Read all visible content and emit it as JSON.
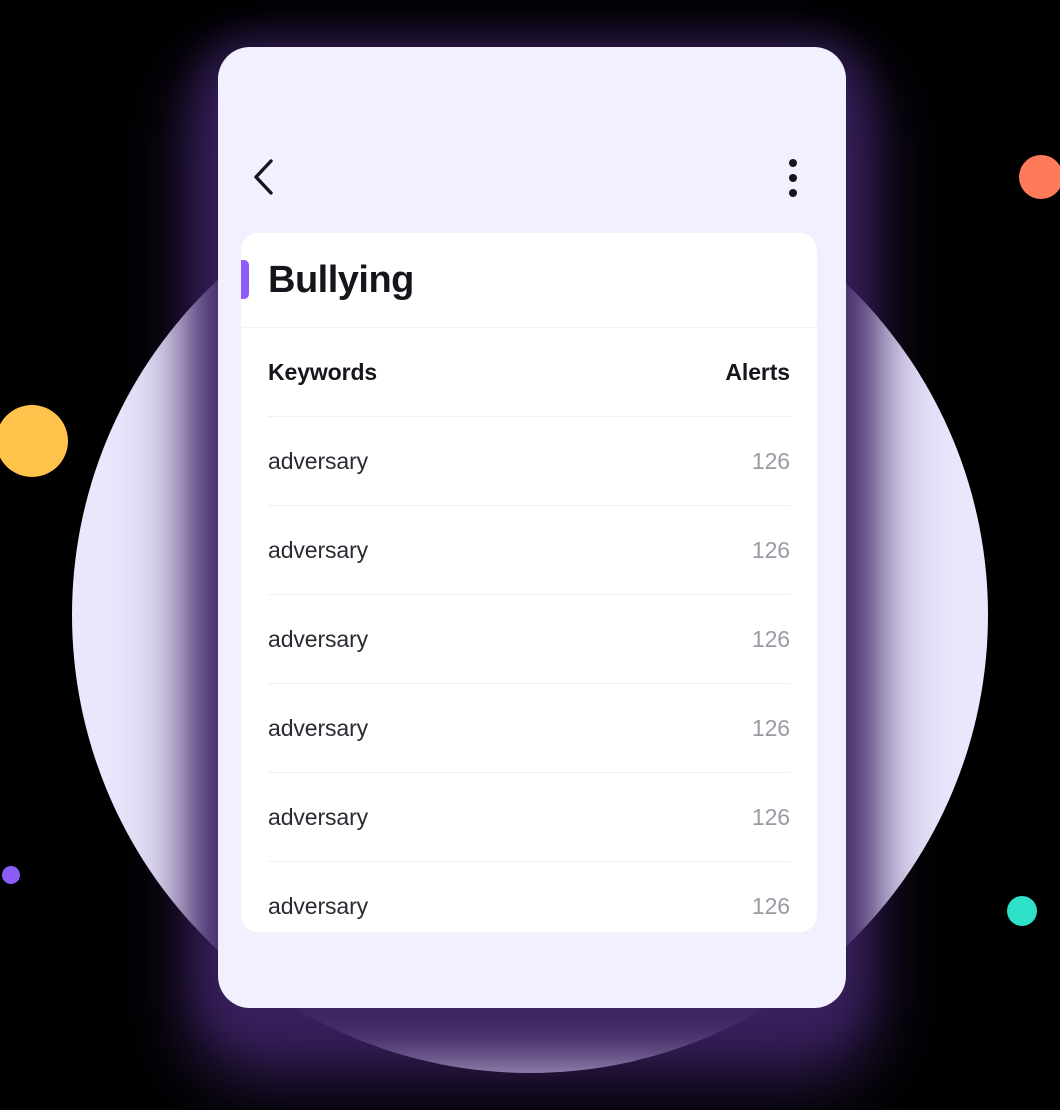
{
  "app": {
    "screen_title": "Bullying"
  },
  "topbar": {
    "back_icon": "chevron-left-icon",
    "menu_icon": "kebab-menu-icon"
  },
  "table": {
    "columns": [
      "Keywords",
      "Alerts"
    ],
    "rows": [
      {
        "keyword": "adversary",
        "alerts": "126"
      },
      {
        "keyword": "adversary",
        "alerts": "126"
      },
      {
        "keyword": "adversary",
        "alerts": "126"
      },
      {
        "keyword": "adversary",
        "alerts": "126"
      },
      {
        "keyword": "adversary",
        "alerts": "126"
      },
      {
        "keyword": "adversary",
        "alerts": "126"
      }
    ]
  },
  "decor": {
    "accent_purple": "#8B5CF6",
    "circle_lavender": "#EAE6FC",
    "dot_orange": "#FF7A59",
    "dot_yellow": "#FFC24B",
    "dot_teal": "#2FE0C8",
    "dot_purple": "#8B5CF6",
    "phone_surface": "#F2F0FE",
    "card_surface": "#FFFFFF",
    "glow_purple": "#3A2160"
  }
}
